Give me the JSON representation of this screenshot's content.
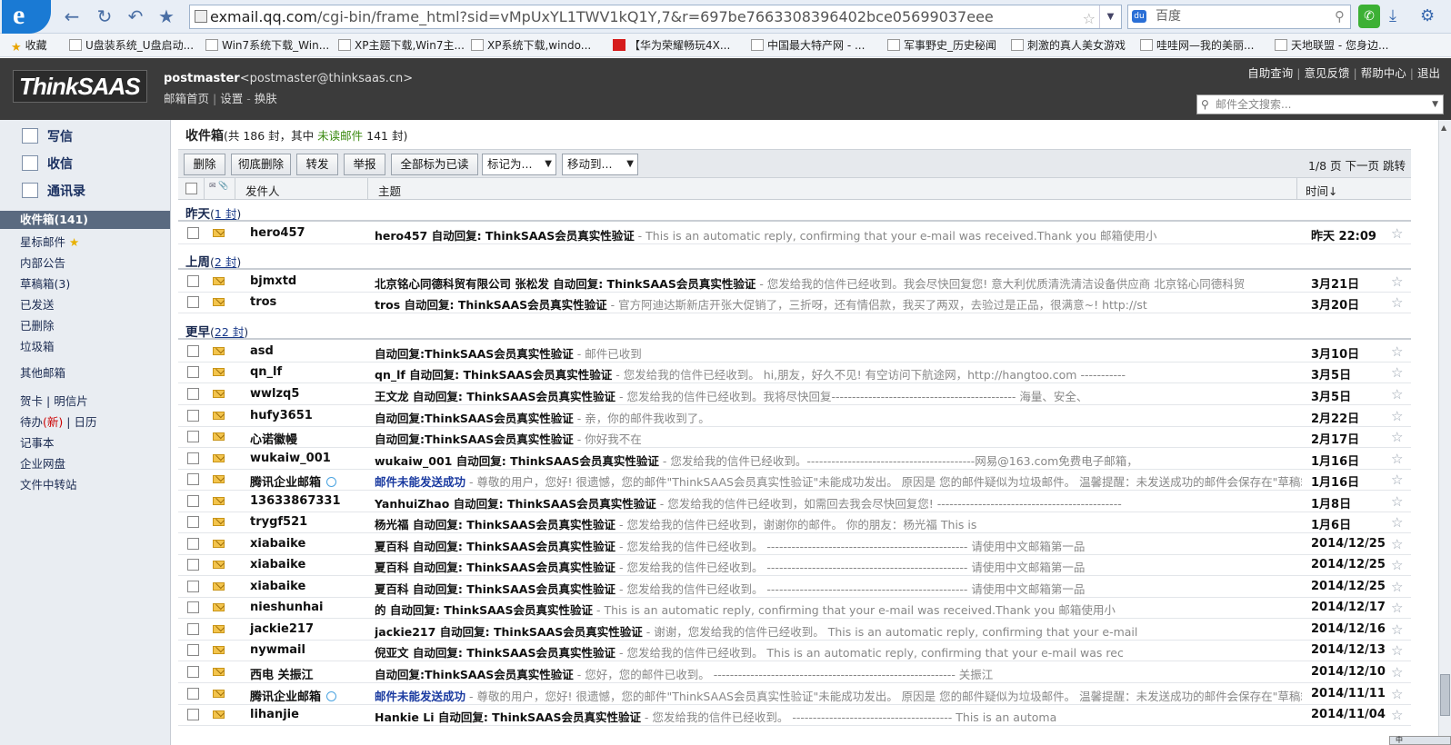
{
  "browser": {
    "url_host": "exmail.qq.com",
    "url_path": "/cgi-bin/frame_html?sid=vMpUxYL1TWV1kQ1Y,7&r=697be7663308396402bce05699037eee",
    "search_placeholder": "百度",
    "bookmarks": [
      {
        "label": "收藏",
        "icon": "star-icon"
      },
      {
        "label": "U盘装系统_U盘启动...",
        "icon": "page-icon"
      },
      {
        "label": "Win7系统下载_Win...",
        "icon": "page-icon"
      },
      {
        "label": "XP主题下载,Win7主...",
        "icon": "page-icon"
      },
      {
        "label": "XP系统下载,windo...",
        "icon": "page-icon"
      },
      {
        "label": "【华为荣耀畅玩4X...",
        "icon": "jd-icon",
        "icon_text": "JD"
      },
      {
        "label": "中国最大特产网 - ...",
        "icon": "page-icon"
      },
      {
        "label": "军事野史_历史秘闻",
        "icon": "page-icon"
      },
      {
        "label": "刺激的真人美女游戏",
        "icon": "page-icon"
      },
      {
        "label": "哇哇网—我的美丽...",
        "icon": "page-icon"
      },
      {
        "label": "天地联盟 - 您身边...",
        "icon": "page-icon"
      }
    ]
  },
  "header": {
    "logo": "ThinkSAAS",
    "account_name": "postmaster",
    "account_email": "<postmaster@thinksaas.cn>",
    "links": [
      "邮箱首页",
      "设置",
      "换肤"
    ],
    "top_links": [
      "自助查询",
      "意见反馈",
      "帮助中心",
      "退出"
    ],
    "search_placeholder": "邮件全文搜索..."
  },
  "sidebar": {
    "actions": [
      "写信",
      "收信",
      "通讯录"
    ],
    "folders": [
      {
        "label": "收件箱(141)",
        "active": true
      },
      {
        "label": "星标邮件",
        "star": true
      },
      {
        "label": "内部公告"
      },
      {
        "label": "草稿箱(3)"
      },
      {
        "label": "已发送"
      },
      {
        "label": "已删除"
      },
      {
        "label": "垃圾箱"
      },
      {
        "label": "其他邮箱"
      }
    ],
    "tools_row1": [
      "贺卡",
      "明信片"
    ],
    "tools_row2_a": "待办",
    "tools_row2_new": "(新)",
    "tools_row2_b": "日历",
    "tools": [
      "记事本",
      "企业网盘",
      "文件中转站"
    ]
  },
  "main": {
    "title": "收件箱",
    "title_sub_pre": "(共 186 封，其中 ",
    "title_unread_label": "未读邮件",
    "title_sub_post": " 141 封)",
    "buttons": [
      "删除",
      "彻底删除",
      "转发",
      "举报",
      "全部标为已读"
    ],
    "mark_select": "标记为...",
    "move_select": "移动到...",
    "pager": "1/8 页 下一页 跳转",
    "columns": {
      "sender": "发件人",
      "subject": "主题",
      "time": "时间↓"
    },
    "groups": [
      {
        "label": "昨天",
        "count": "1 封"
      },
      {
        "label": "上周",
        "count": "2 封"
      },
      {
        "label": "更早",
        "count": "22 封"
      }
    ],
    "emails": [
      {
        "sender": "hero457",
        "subject": "hero457 自动回复: ThinkSAAS会员真实性验证",
        "preview": " -      This is an automatic reply, confirming that your e-mail was received.Thank you   邮箱使用小",
        "date": "昨天 22:09"
      },
      {
        "sender": "bjmxtd",
        "subject": "北京铭心同德科贸有限公司  张松发 自动回复: ThinkSAAS会员真实性验证",
        "preview": " -      您发给我的信件已经收到。我会尽快回复您!       意大利优质清洗清洁设备供应商       北京铭心同德科贸",
        "date": "3月21日"
      },
      {
        "sender": "tros",
        "subject": "tros 自动回复: ThinkSAAS会员真实性验证",
        "preview": " -      官方阿迪达斯新店开张大促销了，三折呀，还有情侣款，我买了两双，去验过是正品，很满意~! http://st",
        "date": "3月20日"
      },
      {
        "sender": "asd",
        "subject": "自动回复:ThinkSAAS会员真实性验证",
        "preview": " - 邮件已收到",
        "date": "3月10日"
      },
      {
        "sender": "qn_lf",
        "subject": "qn_lf 自动回复: ThinkSAAS会员真实性验证",
        "preview": " -      您发给我的信件已经收到。   hi,朋友，好久不见! 有空访问下航途网，http://hangtoo.com -----------",
        "date": "3月5日"
      },
      {
        "sender": "wwlzq5",
        "subject": "王文龙 自动回复: ThinkSAAS会员真实性验证",
        "preview": " -      您发给我的信件已经收到。我将尽快回复--------------------------------------------- 海量、安全、",
        "date": "3月5日"
      },
      {
        "sender": "hufy3651",
        "subject": "自动回复:ThinkSAAS会员真实性验证",
        "preview": " - 亲，你的邮件我收到了。",
        "date": "2月22日"
      },
      {
        "sender": "心诺徽幔",
        "subject": "自动回复:ThinkSAAS会员真实性验证",
        "preview": " - 你好我不在",
        "date": "2月17日"
      },
      {
        "sender": "wukaiw_001",
        "subject": "wukaiw_001 自动回复: ThinkSAAS会员真实性验证",
        "preview": " -      您发给我的信件已经收到。-----------------------------------------网易@163.com免费电子邮箱，",
        "date": "1月16日"
      },
      {
        "sender": "腾讯企业邮箱",
        "qq": true,
        "subject": "邮件未能发送成功",
        "blue": true,
        "preview": " - 尊敬的用户，您好!  很遗憾，您的邮件\"ThinkSAAS会员真实性验证\"未能成功发出。 原因是 您的邮件疑似为垃圾邮件。 温馨提醒：未发送成功的邮件会保存在\"草稿箱\"...",
        "date": "1月16日"
      },
      {
        "sender": "13633867331",
        "subject": "YanhuiZhao 自动回复: ThinkSAAS会员真实性验证",
        "preview": " -      您发给我的信件已经收到，如需回去我会尽快回复您!       ---------------------------------------------",
        "date": "1月8日"
      },
      {
        "sender": "trygf521",
        "subject": "杨光福 自动回复: ThinkSAAS会员真实性验证",
        "preview": " -      您发给我的信件已经收到，谢谢你的邮件。                              你的朋友：杨光福    This is",
        "date": "1月6日"
      },
      {
        "sender": "xiabaike",
        "subject": "夏百科 自动回复: ThinkSAAS会员真实性验证",
        "preview": " -      您发给我的信件已经收到。     ------------------------------------------------- 请使用中文邮箱第一品",
        "date": "2014/12/25"
      },
      {
        "sender": "xiabaike",
        "subject": "夏百科 自动回复: ThinkSAAS会员真实性验证",
        "preview": " -      您发给我的信件已经收到。     ------------------------------------------------- 请使用中文邮箱第一品",
        "date": "2014/12/25"
      },
      {
        "sender": "xiabaike",
        "subject": "夏百科 自动回复: ThinkSAAS会员真实性验证",
        "preview": " -      您发给我的信件已经收到。     ------------------------------------------------- 请使用中文邮箱第一品",
        "date": "2014/12/25"
      },
      {
        "sender": "nieshunhai",
        "subject": "的 自动回复: ThinkSAAS会员真实性验证",
        "preview": " -      This is an automatic reply, confirming that your e-mail was received.Thank you   邮箱使用小",
        "date": "2014/12/17"
      },
      {
        "sender": "jackie217",
        "subject": "jackie217 自动回复: ThinkSAAS会员真实性验证",
        "preview": " -      谢谢，您发给我的信件已经收到。       This is an automatic reply, confirming that your e-mail",
        "date": "2014/12/16"
      },
      {
        "sender": "nywmail",
        "subject": "倪亚文 自动回复: ThinkSAAS会员真实性验证",
        "preview": " -      您发给我的信件已经收到。       This is an automatic reply, confirming that your e-mail was rec",
        "date": "2014/12/13"
      },
      {
        "sender": "西电 关振江",
        "subject": "自动回复:ThinkSAAS会员真实性验证",
        "preview": " - 您好，您的邮件已收到。  ----------------------------------------------------------- 关振江",
        "date": "2014/12/10"
      },
      {
        "sender": "腾讯企业邮箱",
        "qq": true,
        "subject": "邮件未能发送成功",
        "blue": true,
        "preview": " - 尊敬的用户，您好!  很遗憾，您的邮件\"ThinkSAAS会员真实性验证\"未能成功发出。 原因是 您的邮件疑似为垃圾邮件。 温馨提醒：未发送成功的邮件会保存在\"草稿箱\"...",
        "date": "2014/11/11"
      },
      {
        "sender": "lihanjie",
        "subject": "Hankie Li 自动回复: ThinkSAAS会员真实性验证",
        "preview": " -      您发给我的信件已经收到。     ---------------------------------------      This is an automa",
        "date": "2014/11/04"
      }
    ]
  },
  "ime": "中"
}
